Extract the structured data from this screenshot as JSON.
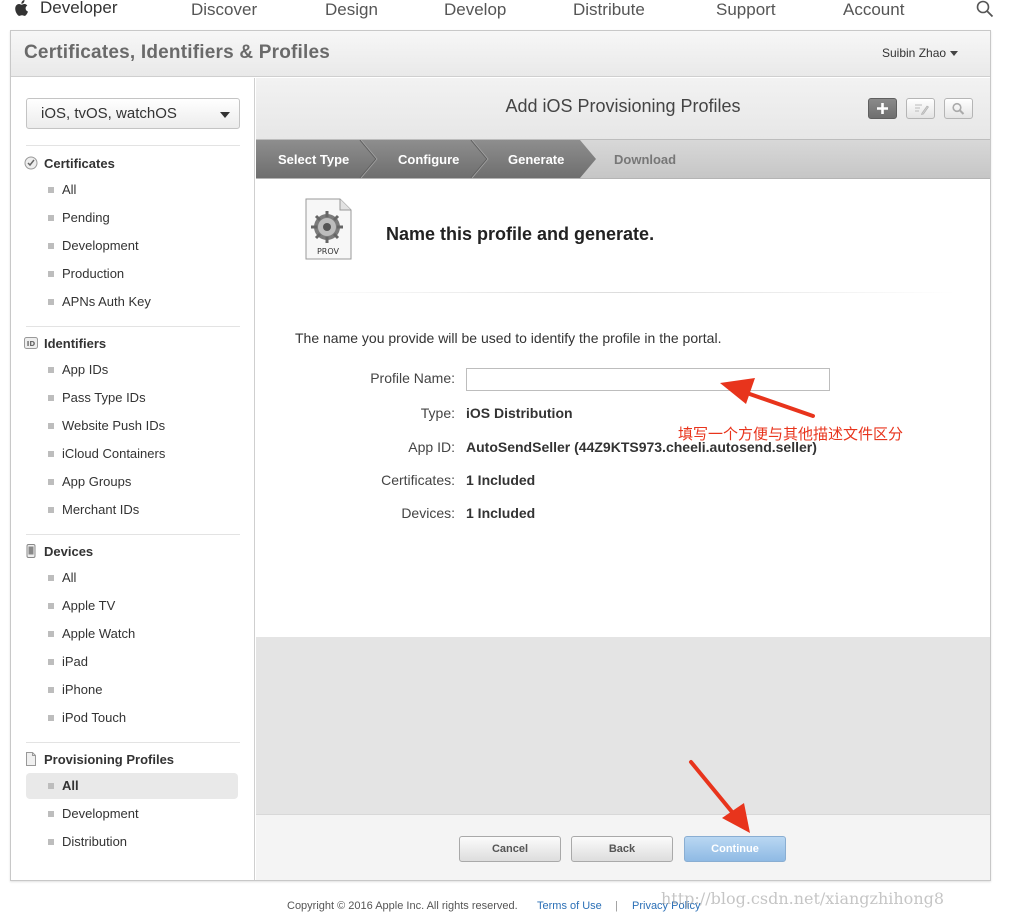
{
  "nav": {
    "brand": "Developer",
    "items": [
      "Discover",
      "Design",
      "Develop",
      "Distribute",
      "Support",
      "Account"
    ]
  },
  "header": {
    "title": "Certificates, Identifiers & Profiles",
    "user": "Suibin Zhao"
  },
  "sidebar": {
    "platform": "iOS, tvOS, watchOS",
    "sections": {
      "certificates": {
        "title": "Certificates",
        "items": [
          "All",
          "Pending",
          "Development",
          "Production",
          "APNs Auth Key"
        ]
      },
      "identifiers": {
        "title": "Identifiers",
        "items": [
          "App IDs",
          "Pass Type IDs",
          "Website Push IDs",
          "iCloud Containers",
          "App Groups",
          "Merchant IDs"
        ]
      },
      "devices": {
        "title": "Devices",
        "items": [
          "All",
          "Apple TV",
          "Apple Watch",
          "iPad",
          "iPhone",
          "iPod Touch"
        ]
      },
      "profiles": {
        "title": "Provisioning Profiles",
        "items": [
          "All",
          "Development",
          "Distribution"
        ],
        "active": "All"
      }
    }
  },
  "main": {
    "title": "Add iOS Provisioning Profiles",
    "steps": [
      "Select Type",
      "Configure",
      "Generate",
      "Download"
    ],
    "active_step": "Generate",
    "prov_icon_label": "PROV",
    "heading": "Name this profile and generate.",
    "description": "The name you provide will be used to identify the profile in the portal.",
    "fields": {
      "profile_name": {
        "label": "Profile Name:",
        "value": "",
        "placeholder": ""
      },
      "type": {
        "label": "Type:",
        "value": "iOS Distribution"
      },
      "app_id": {
        "label": "App ID:",
        "value": "AutoSendSeller (44Z9KTS973.cheeli.autosend.seller)"
      },
      "certificates": {
        "label": "Certificates:",
        "value": "1 Included"
      },
      "devices": {
        "label": "Devices:",
        "value": "1 Included"
      }
    },
    "annotation": "填写一个方便与其他描述文件区分",
    "annotation_color": "#e8341c",
    "buttons": {
      "cancel": "Cancel",
      "back": "Back",
      "continue": "Continue"
    }
  },
  "footer": {
    "copyright": "Copyright © 2016 Apple Inc. All rights reserved.",
    "terms": "Terms of Use",
    "separator": "|",
    "privacy": "Privacy Policy"
  },
  "watermark": "http://blog.csdn.net/xiangzhihong8"
}
